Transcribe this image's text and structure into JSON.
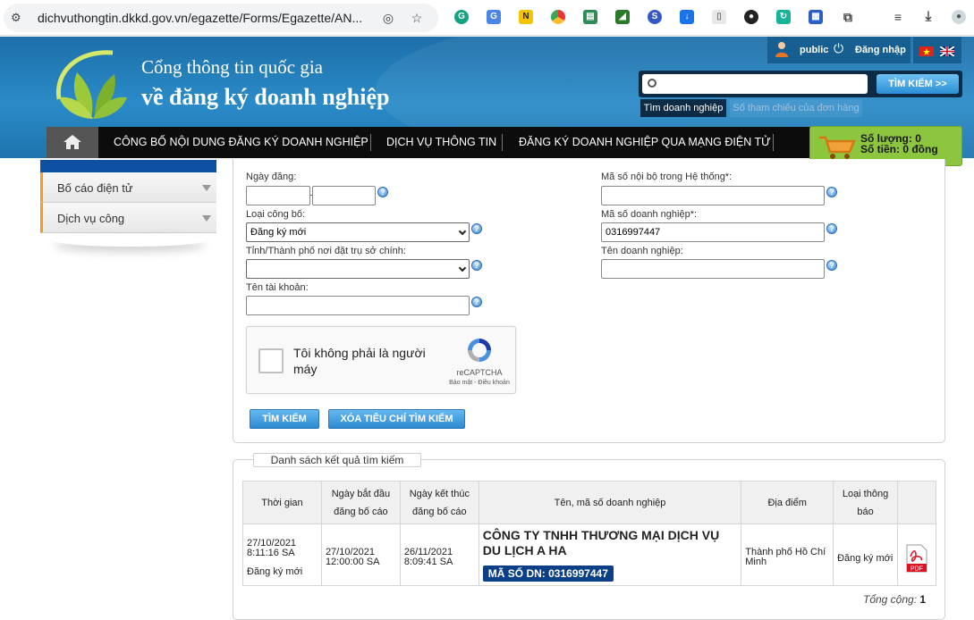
{
  "browser": {
    "url": "dichvuthongtin.dkkd.gov.vn/egazette/Forms/Egazette/AN...",
    "icons": [
      "tune-icon",
      "eye-off-icon",
      "star-icon"
    ],
    "extensions": [
      "grammarly",
      "translate",
      "norton",
      "chrome",
      "print",
      "chart",
      "sigma",
      "download",
      "doc",
      "bear",
      "refresh",
      "apps",
      "puzzle",
      "media",
      "download-arrow",
      "profile"
    ]
  },
  "header": {
    "title_line1": "Cổng thông tin quốc gia",
    "title_line2": "về đăng ký doanh nghiệp",
    "user": "public",
    "login": "Đăng nhập",
    "search_placeholder": "",
    "search_button": "TÌM KIẾM >>",
    "search_tab_active": "Tìm doanh nghiệp",
    "search_tab_inactive": "Số tham chiếu của đơn hàng"
  },
  "nav": {
    "items": [
      "CÔNG BỐ NỘI DUNG ĐĂNG KÝ DOANH NGHIỆP",
      "DỊCH VỤ THÔNG TIN",
      "ĐĂNG KÝ DOANH NGHIỆP QUA MẠNG ĐIỆN TỬ"
    ]
  },
  "cart": {
    "quantity": "Số lượng: 0",
    "amount": "Số tiền: 0 đồng"
  },
  "sidebar": {
    "items": [
      {
        "label": "Bố cáo điện tử"
      },
      {
        "label": "Dịch vụ công"
      }
    ]
  },
  "form": {
    "date_label": "Ngày đăng:",
    "date_from": "",
    "date_to": "",
    "type_label": "Loại công bố:",
    "type_value": "Đăng ký mới",
    "province_label": "Tỉnh/Thành phố nơi đặt trụ sở chính:",
    "province_value": "",
    "account_label": "Tên tài khoản:",
    "account_value": "",
    "internal_code_label": "Mã số nội bộ trong Hệ thống*:",
    "internal_code_value": "",
    "enterprise_code_label": "Mã số doanh nghiệp*:",
    "enterprise_code_value": "0316997447",
    "enterprise_name_label": "Tên doanh nghiệp:",
    "enterprise_name_value": "",
    "captcha_text": "Tôi không phải là người máy",
    "captcha_brand": "reCAPTCHA",
    "captcha_terms": "Bảo mật - Điều khoản",
    "search_button": "TÌM KIẾM",
    "clear_button": "XÓA TIÊU CHÍ TÌM KIẾM"
  },
  "results": {
    "legend": "Danh sách kết quả tìm kiếm",
    "columns": [
      "Thời gian",
      "Ngày bắt đầu đăng bố cáo",
      "Ngày kết thúc đăng bố cáo",
      "Tên, mã số doanh nghiệp",
      "Địa điểm",
      "Loại thông báo",
      ""
    ],
    "rows": [
      {
        "time": "27/10/2021 8:11:16 SA",
        "time_type": "Đăng ký mới",
        "start": "27/10/2021 12:00:00 SA",
        "end": "26/11/2021 8:09:41 SA",
        "company": "CÔNG TY TNHH THƯƠNG MẠI DỊCH VỤ DU LỊCH A HA",
        "code": "MÃ SỐ DN: 0316997447",
        "location": "Thành phố Hồ Chí Minh",
        "notice_type": "Đăng ký mới",
        "pdf": "PDF"
      }
    ],
    "total_label": "Tổng cộng:",
    "total_value": "1"
  }
}
